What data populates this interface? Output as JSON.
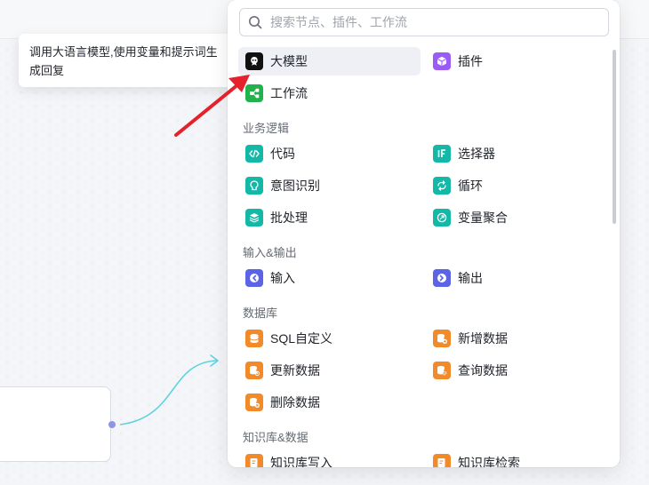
{
  "tooltip": {
    "text": "调用大语言模型,使用变量和提示词生成回复"
  },
  "search": {
    "placeholder": "搜索节点、插件、工作流"
  },
  "colors": {
    "teal": "#14b8a6",
    "indigo": "#5b63e6",
    "orange": "#f28a2a",
    "green": "#22b24c",
    "purple": "#9b5cf5",
    "black": "#111111",
    "arrow": "#e5222b",
    "connector": "#5fd3df"
  },
  "top_items": [
    {
      "label": "大模型",
      "icon": "llm-icon"
    },
    {
      "label": "插件",
      "icon": "plugin-icon"
    },
    {
      "label": "工作流",
      "icon": "workflow-icon"
    }
  ],
  "sections": [
    {
      "title": "业务逻辑",
      "items": [
        {
          "label": "代码",
          "icon": "code-icon"
        },
        {
          "label": "选择器",
          "icon": "if-icon"
        },
        {
          "label": "意图识别",
          "icon": "intent-icon"
        },
        {
          "label": "循环",
          "icon": "loop-icon"
        },
        {
          "label": "批处理",
          "icon": "batch-icon"
        },
        {
          "label": "变量聚合",
          "icon": "aggregate-icon"
        }
      ]
    },
    {
      "title": "输入&输出",
      "items": [
        {
          "label": "输入",
          "icon": "input-icon"
        },
        {
          "label": "输出",
          "icon": "output-icon"
        }
      ]
    },
    {
      "title": "数据库",
      "items": [
        {
          "label": "SQL自定义",
          "icon": "sql-icon"
        },
        {
          "label": "新增数据",
          "icon": "db-add-icon"
        },
        {
          "label": "更新数据",
          "icon": "db-update-icon"
        },
        {
          "label": "查询数据",
          "icon": "db-query-icon"
        },
        {
          "label": "删除数据",
          "icon": "db-delete-icon"
        }
      ]
    },
    {
      "title": "知识库&数据",
      "items": [
        {
          "label": "知识库写入",
          "icon": "kb-write-icon"
        },
        {
          "label": "知识库检索",
          "icon": "kb-search-icon"
        }
      ]
    }
  ]
}
